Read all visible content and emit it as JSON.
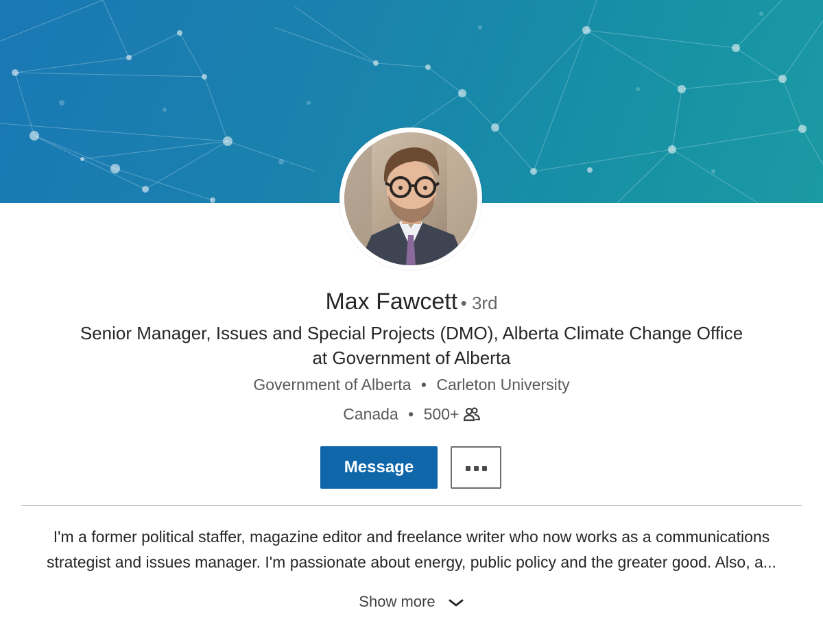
{
  "profile": {
    "name": "Max Fawcett",
    "degree": "3rd",
    "headline_line1": "Senior Manager, Issues and Special Projects (DMO), Alberta Climate Change Office",
    "headline_line2": "at Government of Alberta",
    "company": "Government of Alberta",
    "school": "Carleton University",
    "location": "Canada",
    "connections": "500+",
    "connections_icon": "people-icon"
  },
  "actions": {
    "message_label": "Message",
    "more_icon": "ellipsis-icon"
  },
  "about": {
    "line1": "I'm a former political staffer, magazine editor and freelance writer who now works as a communications",
    "line2": "strategist and issues manager. I'm passionate about energy, public policy and the greater good. Also, a...",
    "show_more_label": "Show more",
    "show_more_icon": "chevron-down-icon"
  },
  "colors": {
    "banner_start": "#1a78b4",
    "banner_end": "#1a9aa3",
    "primary_button": "#0f66a8"
  }
}
